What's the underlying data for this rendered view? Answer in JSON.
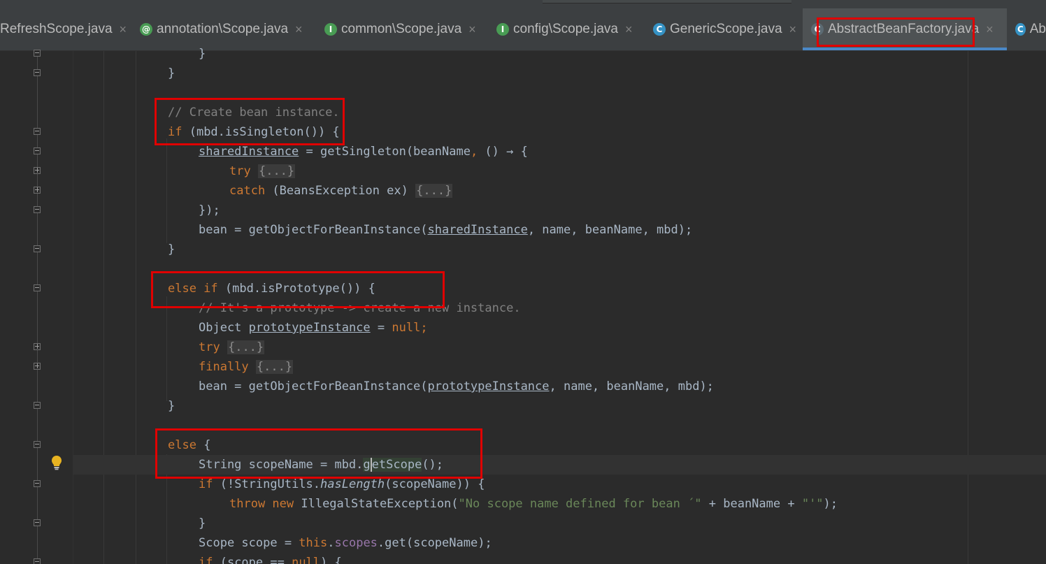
{
  "tabs": [
    {
      "label": "RefreshScope.java",
      "icon": "none",
      "close": "×"
    },
    {
      "label": "annotation\\Scope.java",
      "icon": "annotation-icon",
      "icon_glyph": "@",
      "close": "×"
    },
    {
      "label": "common\\Scope.java",
      "icon": "interface-icon",
      "icon_glyph": "I",
      "close": "×"
    },
    {
      "label": "config\\Scope.java",
      "icon": "interface-icon",
      "icon_glyph": "I",
      "close": "×"
    },
    {
      "label": "GenericScope.java",
      "icon": "class-icon",
      "icon_glyph": "C",
      "close": "×"
    },
    {
      "label": "AbstractBeanFactory.java",
      "icon": "abstract-class-icon",
      "icon_glyph": "C",
      "close": "×",
      "active": true
    },
    {
      "label": "Ab",
      "icon": "class-icon",
      "icon_glyph": "C"
    }
  ],
  "code": {
    "l0": "}",
    "l1": "}",
    "l3": "// Create bean instance.",
    "l4_kw": "if",
    "l4_rest": " (mbd.isSingleton()) {",
    "l5_a": "sharedInstance",
    "l5_b": " = getSingleton(beanName",
    "l5_c": ",",
    "l5_d": " () → {",
    "l6_kw": "try",
    "l6_fold": "{...}",
    "l7_kw": "catch",
    "l7_rest": " (BeansException ex) ",
    "l7_fold": "{...}",
    "l8": "});",
    "l9_a": "bean = getObjectForBeanInstance(",
    "l9_b": "sharedInstance",
    "l9_c": ", name, beanName, mbd);",
    "l10": "}",
    "l12_kw": "else if",
    "l12_rest": " (mbd.isPrototype()) {",
    "l13": "// It's a prototype -> create a new instance.",
    "l14_a": "Object ",
    "l14_b": "prototypeInstance",
    "l14_c": " = ",
    "l14_d": "null",
    "l14_e": ";",
    "l15_kw": "try",
    "l15_fold": "{...}",
    "l16_kw": "finally",
    "l16_fold": "{...}",
    "l17_a": "bean = getObjectForBeanInstance(",
    "l17_b": "prototypeInstance",
    "l17_c": ", name, beanName, mbd);",
    "l18": "}",
    "l20_kw": "else",
    "l20_rest": " {",
    "l21_a": "String scopeName = mbd.",
    "l21_b": "g",
    "l21_c": "etScope",
    "l21_d": "();",
    "l22_kw": "if",
    "l22_a": " (!StringUtils.",
    "l22_b": "hasLength",
    "l22_c": "(scopeName)) {",
    "l23_kw": "throw new",
    "l23_a": " IllegalStateException(",
    "l23_str1": "\"No scope name defined for bean ´\"",
    "l23_b": " + beanName + ",
    "l23_str2": "\"'\"",
    "l23_c": ");",
    "l24": "}",
    "l25_a": "Scope scope = ",
    "l25_kw": "this",
    "l25_b": ".",
    "l25_fld": "scopes",
    "l25_c": ".get(scopeName);",
    "l26_kw": "if",
    "l26_a": " (scope == ",
    "l26_null": "null",
    "l26_b": ") {"
  },
  "colors": {
    "keyword": "#cc7832",
    "comment": "#808080",
    "string": "#6a8759",
    "field": "#9876aa",
    "text": "#a9b7c6",
    "highlight_box": "#e00000",
    "active_tab_underline": "#4a88c7"
  }
}
